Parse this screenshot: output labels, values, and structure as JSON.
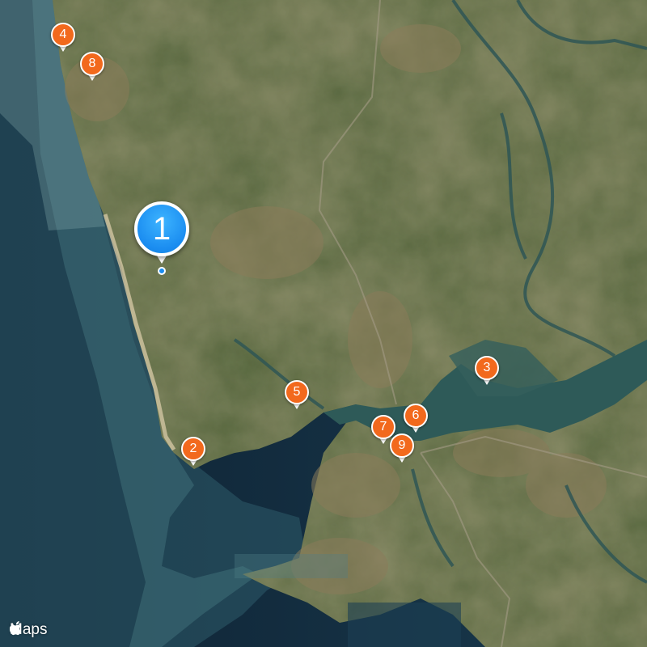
{
  "map": {
    "attribution": "Maps",
    "colors": {
      "ocean_deep": "#102437",
      "ocean_shallow": "#3b6b78",
      "land": "#4a5d35",
      "land_dry": "#7a6a48",
      "estuary": "#2f5a5a",
      "beach": "#cdbf9c",
      "pin_orange": "#f2691d",
      "pin_blue": "#1a8cf0"
    },
    "markers": [
      {
        "label": "1",
        "style": "primary",
        "color": "#1a8cf0"
      },
      {
        "label": "2",
        "style": "secondary",
        "color": "#f2691d"
      },
      {
        "label": "3",
        "style": "secondary",
        "color": "#f2691d"
      },
      {
        "label": "4",
        "style": "secondary",
        "color": "#f2691d"
      },
      {
        "label": "5",
        "style": "secondary",
        "color": "#f2691d"
      },
      {
        "label": "6",
        "style": "secondary",
        "color": "#f2691d"
      },
      {
        "label": "7",
        "style": "secondary",
        "color": "#f2691d"
      },
      {
        "label": "8",
        "style": "secondary",
        "color": "#f2691d"
      },
      {
        "label": "9",
        "style": "secondary",
        "color": "#f2691d"
      }
    ]
  }
}
